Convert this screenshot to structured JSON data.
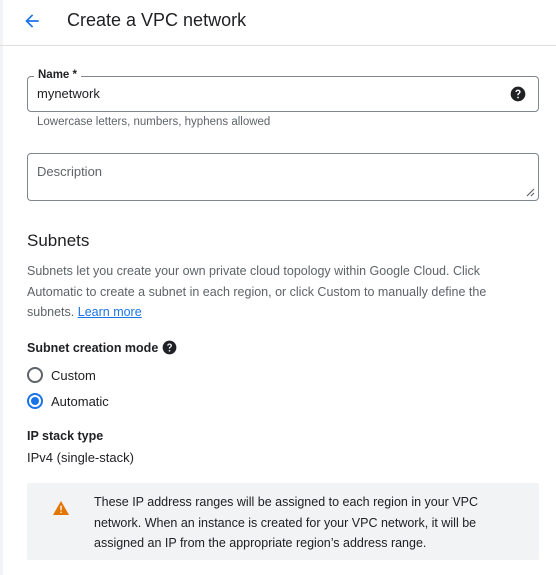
{
  "header": {
    "title": "Create a VPC network",
    "back_icon": "arrow-back-icon"
  },
  "name_field": {
    "label": "Name *",
    "value": "mynetwork",
    "hint": "Lowercase letters, numbers, hyphens allowed",
    "help_icon": "help-circle-icon"
  },
  "description_field": {
    "placeholder": "Description",
    "value": ""
  },
  "subnets": {
    "title": "Subnets",
    "description": "Subnets let you create your own private cloud topology within Google Cloud. Click Automatic to create a subnet in each region, or click Custom to manually define the subnets.",
    "learn_more": "Learn more",
    "creation_mode": {
      "label": "Subnet creation mode",
      "options": [
        {
          "label": "Custom",
          "selected": false
        },
        {
          "label": "Automatic",
          "selected": true
        }
      ]
    }
  },
  "ip_stack": {
    "label": "IP stack type",
    "value": "IPv4 (single-stack)"
  },
  "notice": {
    "icon": "warning-icon",
    "text": "These IP address ranges will be assigned to each region in your VPC network. When an instance is created for your VPC network, it will be assigned an IP from the appropriate region’s address range."
  },
  "colors": {
    "accent": "#1a73e8",
    "warning": "#e37400",
    "notice_bg": "#f1f3f4"
  }
}
